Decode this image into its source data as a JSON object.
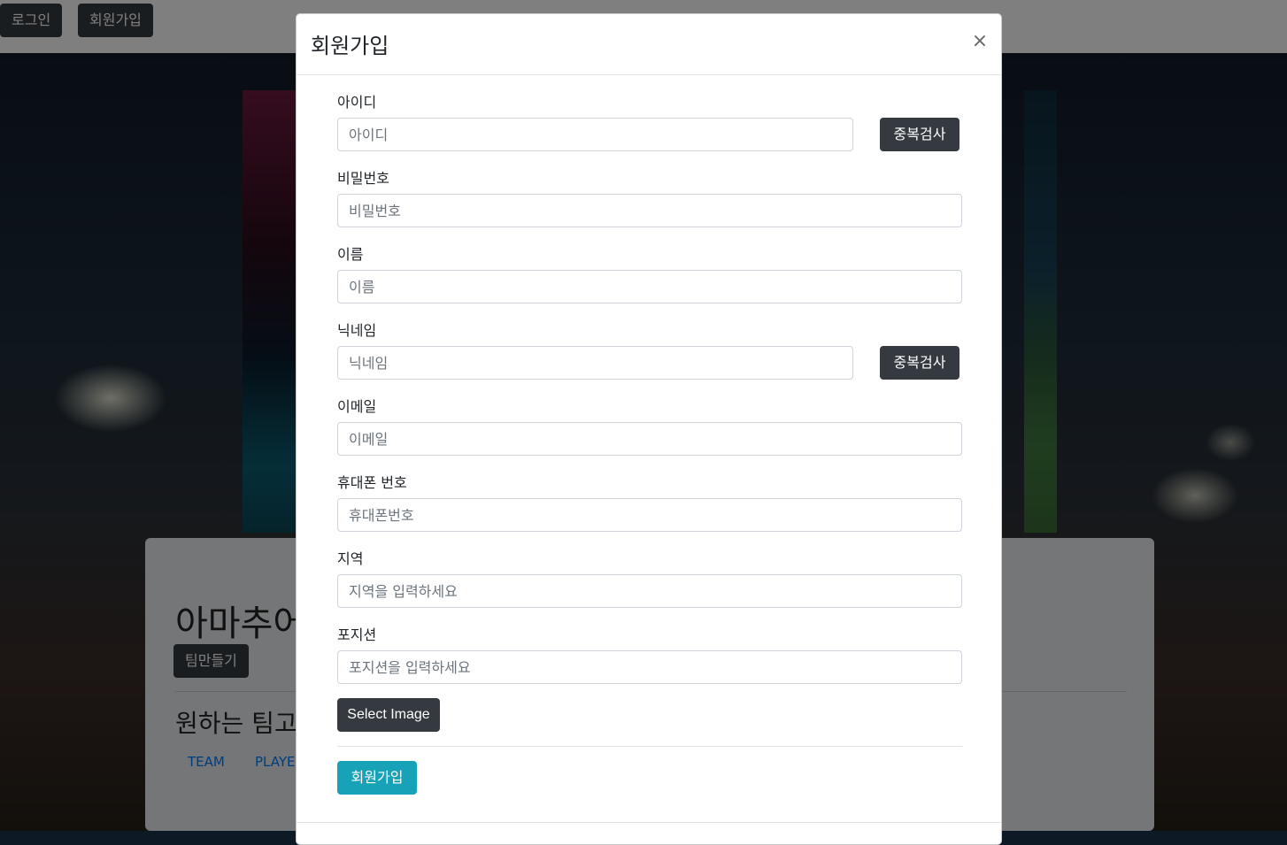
{
  "topbar": {
    "login_label": "로그인",
    "signup_label": "회원가입"
  },
  "jumbotron": {
    "title": "아마추어",
    "make_team_label": "팀만들기",
    "subtitle": "원하는 팀고",
    "links": [
      "TEAM",
      "PLAYER"
    ]
  },
  "modal": {
    "title": "회원가입",
    "close_symbol": "×",
    "fields": [
      {
        "label": "아이디",
        "placeholder": "아이디",
        "check_label": "중복검사"
      },
      {
        "label": "비밀번호",
        "placeholder": "비밀번호"
      },
      {
        "label": "이름",
        "placeholder": "이름"
      },
      {
        "label": "닉네임",
        "placeholder": "닉네임",
        "check_label": "중복검사"
      },
      {
        "label": "이메일",
        "placeholder": "이메일"
      },
      {
        "label": "휴대폰 번호",
        "placeholder": "휴대폰번호"
      },
      {
        "label": "지역",
        "placeholder": "지역을 입력하세요"
      },
      {
        "label": "포지션",
        "placeholder": "포지션을 입력하세요"
      }
    ],
    "select_image_label": "Select Image",
    "submit_label": "회원가입"
  },
  "colors": {
    "dark_button": "#343a40",
    "submit_button": "#17a2b8",
    "link": "#007bff"
  }
}
